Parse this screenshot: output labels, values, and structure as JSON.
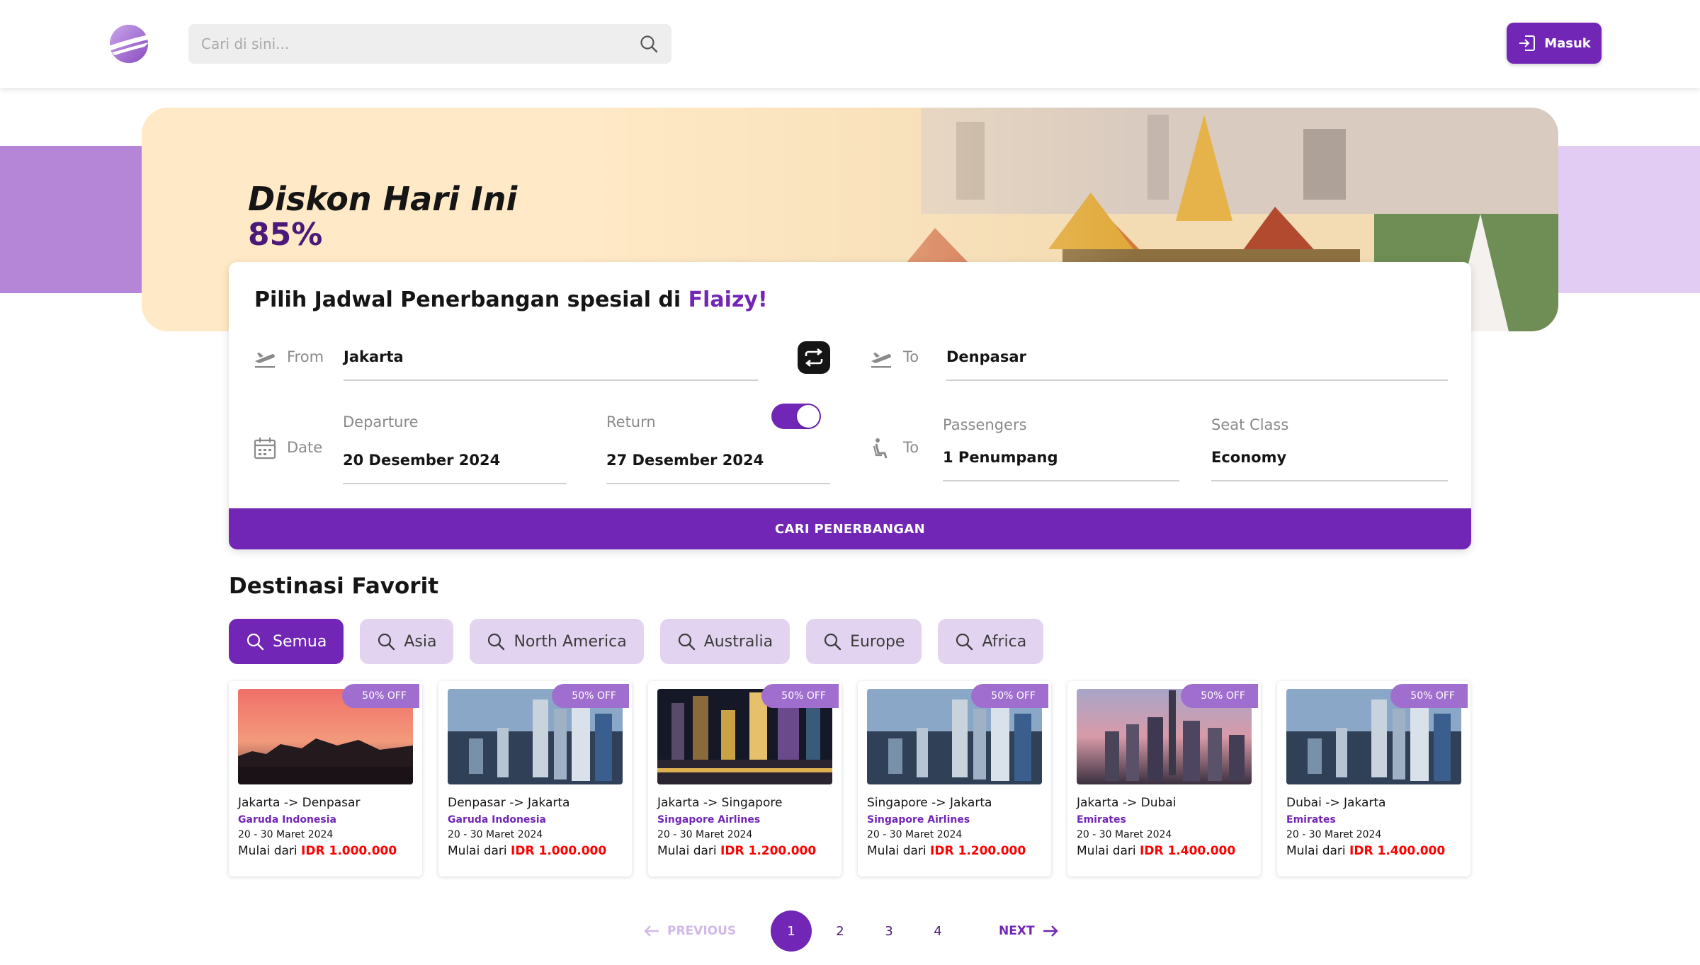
{
  "nav": {
    "search_placeholder": "Cari di sini...",
    "login_label": "Masuk"
  },
  "promo": {
    "title": "Diskon Hari Ini",
    "percent": "85%"
  },
  "form": {
    "title_prefix": "Pilih Jadwal Penerbangan spesial di ",
    "title_brand": "Flaizy!",
    "from_label": "From",
    "from_value": "Jakarta",
    "to_label": "To",
    "to_value": "Denpasar",
    "date_label": "Date",
    "departure_label": "Departure",
    "departure_value": "20 Desember 2024",
    "return_label": "Return",
    "return_value": "27 Desember 2024",
    "return_enabled": true,
    "passenger_label": "To",
    "passengers_label": "Passengers",
    "passengers_value": "1 Penumpang",
    "seat_label": "Seat Class",
    "seat_value": "Economy",
    "submit_label": "CARI PENERBANGAN"
  },
  "destinations": {
    "title": "Destinasi Favorit",
    "filters": [
      {
        "label": "Semua",
        "active": true
      },
      {
        "label": "Asia",
        "active": false
      },
      {
        "label": "North America",
        "active": false
      },
      {
        "label": "Australia",
        "active": false
      },
      {
        "label": "Europe",
        "active": false
      },
      {
        "label": "Africa",
        "active": false
      }
    ],
    "price_prefix": "Mulai dari",
    "items": [
      {
        "badge": "50% OFF",
        "route": "Jakarta -> Denpasar",
        "airline": "Garuda Indonesia",
        "dates": "20 - 30 Maret 2024",
        "price": "IDR 1.000.000",
        "scene": "sunset"
      },
      {
        "badge": "50% OFF",
        "route": "Denpasar -> Jakarta",
        "airline": "Garuda Indonesia",
        "dates": "20 - 30 Maret 2024",
        "price": "IDR 1.000.000",
        "scene": "city"
      },
      {
        "badge": "50% OFF",
        "route": "Jakarta -> Singapore",
        "airline": "Singapore Airlines",
        "dates": "20 - 30 Maret 2024",
        "price": "IDR 1.200.000",
        "scene": "night"
      },
      {
        "badge": "50% OFF",
        "route": "Singapore -> Jakarta",
        "airline": "Singapore Airlines",
        "dates": "20 - 30 Maret 2024",
        "price": "IDR 1.200.000",
        "scene": "city"
      },
      {
        "badge": "50% OFF",
        "route": "Jakarta -> Dubai",
        "airline": "Emirates",
        "dates": "20 - 30 Maret 2024",
        "price": "IDR 1.400.000",
        "scene": "dusk"
      },
      {
        "badge": "50% OFF",
        "route": "Dubai -> Jakarta",
        "airline": "Emirates",
        "dates": "20 - 30 Maret 2024",
        "price": "IDR 1.400.000",
        "scene": "city"
      }
    ]
  },
  "pagination": {
    "prev_label": "PREVIOUS",
    "next_label": "NEXT",
    "pages": [
      "1",
      "2",
      "3",
      "4"
    ],
    "current": "1"
  },
  "colors": {
    "primary": "#7126b5",
    "primary_dark": "#4b1979",
    "chip_bg": "#e2d4f0",
    "price_red": "#ff0000"
  }
}
